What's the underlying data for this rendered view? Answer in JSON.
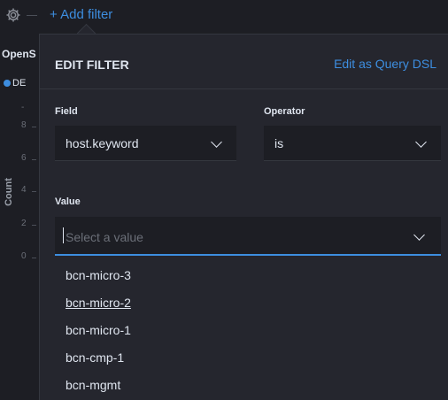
{
  "toolbar": {
    "gear_icon": "gear-icon",
    "add_filter": "+ Add filter"
  },
  "background": {
    "panel_title": "OpenS",
    "legend_label": "DE",
    "y_axis_label": "Count",
    "y_ticks": [
      "-",
      "8",
      "6",
      "4",
      "2",
      "0"
    ]
  },
  "edit_filter": {
    "title": "EDIT FILTER",
    "edit_dsl_link": "Edit as Query DSL",
    "field_label": "Field",
    "field_value": "host.keyword",
    "operator_label": "Operator",
    "operator_value": "is",
    "value_label": "Value",
    "value_placeholder": "Select a value",
    "options": [
      "bcn-micro-3",
      "bcn-micro-2",
      "bcn-micro-1",
      "bcn-cmp-1",
      "bcn-mgmt"
    ],
    "hovered_option": "bcn-micro-2"
  },
  "colors": {
    "accent": "#3d8ee0",
    "panel_bg": "#25262e",
    "page_bg": "#1d1e24"
  }
}
